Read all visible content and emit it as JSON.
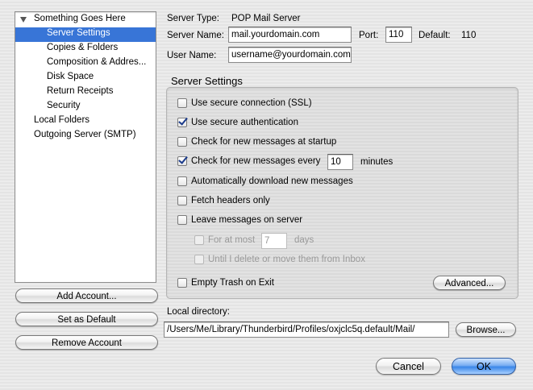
{
  "sidebar": {
    "items": [
      {
        "label": "Something Goes Here",
        "indent": 0,
        "expanded": true
      },
      {
        "label": "Server Settings",
        "indent": 1,
        "selected": true
      },
      {
        "label": "Copies & Folders",
        "indent": 1
      },
      {
        "label": "Composition & Addres...",
        "indent": 1
      },
      {
        "label": "Disk Space",
        "indent": 1
      },
      {
        "label": "Return Receipts",
        "indent": 1
      },
      {
        "label": "Security",
        "indent": 1
      },
      {
        "label": "Local Folders",
        "indent": 0
      },
      {
        "label": "Outgoing Server (SMTP)",
        "indent": 0
      }
    ],
    "add_account": "Add Account...",
    "set_default": "Set as Default",
    "remove_account": "Remove Account"
  },
  "server": {
    "type_label": "Server Type:",
    "type_value": "POP Mail Server",
    "name_label": "Server Name:",
    "name_value": "mail.yourdomain.com",
    "port_label": "Port:",
    "port_value": "110",
    "default_label": "Default:",
    "default_value": "110",
    "user_label": "User Name:",
    "user_value": "username@yourdomain.com"
  },
  "settings": {
    "title": "Server Settings",
    "ssl": "Use secure connection (SSL)",
    "secure_auth": "Use secure authentication",
    "check_startup": "Check for new messages at startup",
    "check_every": "Check for new messages every",
    "check_every_value": "10",
    "minutes": "minutes",
    "auto_download": "Automatically download new messages",
    "fetch_headers": "Fetch headers only",
    "leave_on_server": "Leave messages on server",
    "for_at_most": "For at most",
    "for_at_most_value": "7",
    "days": "days",
    "until_delete": "Until I delete or move them from Inbox",
    "empty_trash": "Empty Trash on Exit",
    "advanced": "Advanced..."
  },
  "local": {
    "label": "Local directory:",
    "path": "/Users/Me/Library/Thunderbird/Profiles/oxjclc5q.default/Mail/",
    "browse": "Browse..."
  },
  "dialog": {
    "cancel": "Cancel",
    "ok": "OK"
  }
}
